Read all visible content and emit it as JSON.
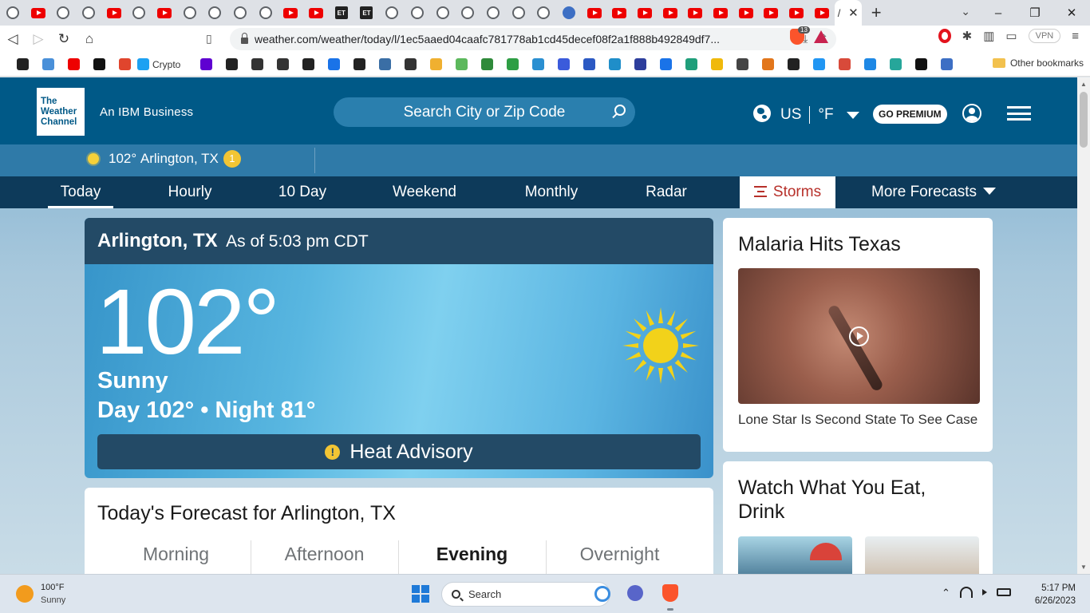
{
  "browser": {
    "tabs": [
      {
        "icon": "globe-icon"
      },
      {
        "icon": "youtube-icon"
      },
      {
        "icon": "globe-icon"
      },
      {
        "icon": "globe-icon"
      },
      {
        "icon": "youtube-icon"
      },
      {
        "icon": "globe-icon"
      },
      {
        "icon": "youtube-icon"
      },
      {
        "icon": "globe-icon"
      },
      {
        "icon": "globe-icon"
      },
      {
        "icon": "globe-icon"
      },
      {
        "icon": "globe-icon"
      },
      {
        "icon": "youtube-icon"
      },
      {
        "icon": "youtube-icon"
      },
      {
        "icon": "et-icon",
        "label": "ET"
      },
      {
        "icon": "et-icon",
        "label": "ET"
      },
      {
        "icon": "globe-icon"
      },
      {
        "icon": "globe-icon"
      },
      {
        "icon": "globe-icon"
      },
      {
        "icon": "globe-icon"
      },
      {
        "icon": "globe-icon"
      },
      {
        "icon": "globe-icon"
      },
      {
        "icon": "globe-icon"
      },
      {
        "icon": "web-globe-icon"
      },
      {
        "icon": "youtube-icon"
      },
      {
        "icon": "youtube-icon"
      },
      {
        "icon": "youtube-icon"
      },
      {
        "icon": "youtube-icon"
      },
      {
        "icon": "youtube-icon"
      },
      {
        "icon": "youtube-icon"
      },
      {
        "icon": "youtube-icon"
      },
      {
        "icon": "youtube-icon"
      },
      {
        "icon": "youtube-icon"
      },
      {
        "icon": "youtube-icon"
      }
    ],
    "active_tab": {
      "label": "/",
      "close": "✕"
    },
    "new_tab": "+",
    "window_controls": {
      "tab_search": "⌄",
      "minimize": "–",
      "maximize": "❐",
      "close": "✕"
    },
    "nav": {
      "back": "◁",
      "forward": "▷",
      "reload": "↻",
      "home": "⌂",
      "bookmark": "▯"
    },
    "url": "weather.com/weather/today/l/1ec5aaed04caafc781778ab1cd45decef08f2a1f888b492849df7...",
    "omni_icons": {
      "install": "⤓",
      "share": "⇪"
    },
    "brave_badge": "13",
    "vpn_label": "VPN",
    "bookmarks": [
      {
        "icon": "github-icon",
        "color": "#222"
      },
      {
        "icon": "chart-icon",
        "color": "#4a90d9"
      },
      {
        "icon": "youtube-icon",
        "color": "#e00"
      },
      {
        "icon": "dark-square-icon",
        "color": "#111"
      },
      {
        "icon": "round-badge-icon",
        "color": "#e0452d"
      }
    ],
    "bookmark_crypto": {
      "icon": "twitter-bird-icon",
      "label": "Crypto",
      "color": "#1da1f2"
    },
    "bookmarks_more": [
      {
        "icon": "yahoo-icon",
        "color": "#5f01d1"
      },
      {
        "icon": "stripe-icon",
        "color": "#222"
      },
      {
        "icon": "coin-icon",
        "color": "#333"
      },
      {
        "icon": "edge-icon",
        "color": "#333"
      },
      {
        "icon": "amazon-icon",
        "color": "#222"
      },
      {
        "icon": "scan-icon",
        "color": "#1a73e8"
      },
      {
        "icon": "ct-icon",
        "color": "#222"
      },
      {
        "icon": "chart-box-icon",
        "color": "#3a6ea5"
      },
      {
        "icon": "grid-icon",
        "color": "#333"
      },
      {
        "icon": "cloud-icon",
        "color": "#f0b030"
      },
      {
        "icon": "w-icon",
        "color": "#5cb85c"
      },
      {
        "icon": "td-icon",
        "color": "#2f8a3a"
      },
      {
        "icon": "green-chart-icon",
        "color": "#2e9e44"
      },
      {
        "icon": "globe-blue-icon",
        "color": "#2a8fd1"
      },
      {
        "icon": "at-icon",
        "color": "#3b5bdb"
      },
      {
        "icon": "c-icon",
        "color": "#2b59c3"
      },
      {
        "icon": "copy-icon",
        "color": "#1f8ec9"
      },
      {
        "icon": "arch-icon",
        "color": "#2d3e9c"
      },
      {
        "icon": "c-circle-icon",
        "color": "#1a73e8"
      },
      {
        "icon": "k-icon",
        "color": "#1f9e7a"
      },
      {
        "icon": "binance-icon",
        "color": "#f0b90b"
      },
      {
        "icon": "t-icon",
        "color": "#444"
      },
      {
        "icon": "metamask-icon",
        "color": "#e2761b"
      },
      {
        "icon": "dark-app-icon",
        "color": "#222"
      },
      {
        "icon": "blue-square-icon",
        "color": "#2196f3"
      },
      {
        "icon": "red-triangle-icon",
        "color": "#d84a3a"
      },
      {
        "icon": "f-circle-icon",
        "color": "#1e88e5"
      },
      {
        "icon": "teal-icon",
        "color": "#26a69a"
      },
      {
        "icon": "black-circle-icon",
        "color": "#111"
      },
      {
        "icon": "web-icon",
        "color": "#3d6fc4"
      }
    ],
    "other_bookmarks": "Other bookmarks"
  },
  "site": {
    "logo": [
      "The",
      "Weather",
      "Channel"
    ],
    "tagline": "An IBM Business",
    "search": {
      "placeholder": "Search City or Zip Code"
    },
    "locale": {
      "country": "US",
      "unit": "°F"
    },
    "premium_label": "GO PREMIUM",
    "location": {
      "temp": "102°",
      "city": "Arlington, TX",
      "alert_count": "1"
    },
    "nav": [
      {
        "key": "today",
        "label": "Today"
      },
      {
        "key": "hourly",
        "label": "Hourly"
      },
      {
        "key": "ten-day",
        "label": "10 Day"
      },
      {
        "key": "weekend",
        "label": "Weekend"
      },
      {
        "key": "monthly",
        "label": "Monthly"
      },
      {
        "key": "radar",
        "label": "Radar"
      },
      {
        "key": "storms",
        "label": "Storms"
      },
      {
        "key": "more",
        "label": "More Forecasts"
      }
    ],
    "current": {
      "city": "Arlington, TX",
      "as_of": "As of 5:03 pm CDT",
      "temp": "102°",
      "condition": "Sunny",
      "day_night": "Day 102° • Night 81°",
      "advisory": "Heat Advisory",
      "advisory_icon": "!"
    },
    "forecast": {
      "title": "Today's Forecast for Arlington, TX",
      "tabs": [
        "Morning",
        "Afternoon",
        "Evening",
        "Overnight"
      ],
      "active_tab": "Evening"
    },
    "rail": {
      "malaria": {
        "title": "Malaria Hits Texas",
        "caption": "Lone Star Is Second State To See Case"
      },
      "eat": {
        "title": "Watch What You Eat, Drink"
      }
    },
    "colors": {
      "header": "#005987",
      "subnav": "#0d3a5a",
      "storms": "#b7302a",
      "alert": "#f2c534"
    }
  },
  "taskbar": {
    "weather": {
      "temp": "100°F",
      "condition": "Sunny"
    },
    "search_label": "Search",
    "tray_chevron": "⌃",
    "time": "5:17 PM",
    "date": "6/26/2023"
  }
}
